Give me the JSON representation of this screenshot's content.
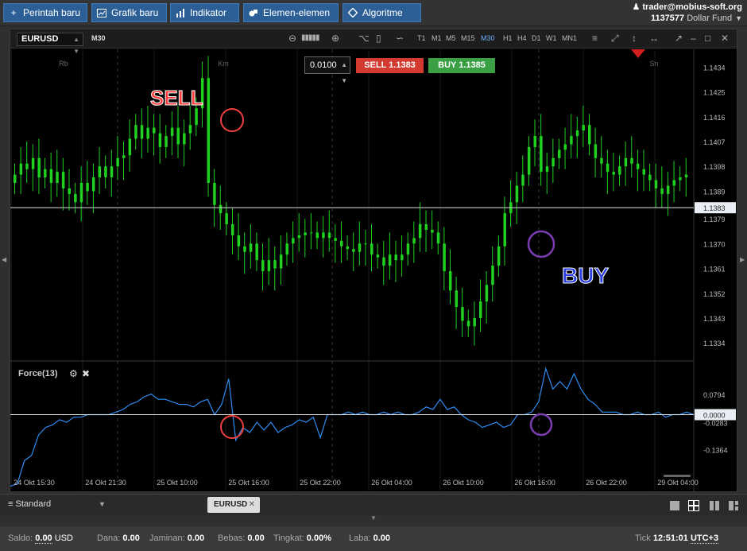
{
  "toolbar": {
    "buttons": [
      {
        "label": "Perintah baru",
        "icon": "plus-icon"
      },
      {
        "label": "Grafik baru",
        "icon": "chart-window-icon"
      },
      {
        "label": "Indikator",
        "icon": "bar-chart-icon"
      },
      {
        "label": "Elemen-elemen",
        "icon": "shapes-icon"
      },
      {
        "label": "Algoritme",
        "icon": "diamond-icon"
      }
    ]
  },
  "account": {
    "email": "trader@mobius-soft.org",
    "number": "1137577",
    "fund": "Dollar Fund"
  },
  "chart_toolbar": {
    "symbol": "EURUSD",
    "timeframe_current": "M30",
    "timeframes": [
      "T1",
      "M1",
      "M5",
      "M15",
      "M30",
      "H1",
      "H4",
      "D1",
      "W1",
      "MN1"
    ],
    "active_timeframe": "M30"
  },
  "trade": {
    "lot": "0.0100",
    "sell_label": "SELL 1.1383",
    "buy_label": "BUY 1.1385"
  },
  "annotations": {
    "sell": "SELL",
    "buy": "BUY"
  },
  "indicator": {
    "title": "Force(13)"
  },
  "chart_data": [
    {
      "type": "candlestick",
      "title": "EURUSD M30",
      "y_ticks": [
        "1.1434",
        "1.1425",
        "1.1416",
        "1.1407",
        "1.1398",
        "1.1389",
        "1.1379",
        "1.1370",
        "1.1361",
        "1.1352",
        "1.1343",
        "1.1334"
      ],
      "current_price": "1.1383",
      "day_labels": [
        "Rb",
        "Km",
        "Sn"
      ],
      "x_ticks": [
        "24 Okt 15:30",
        "24 Okt 21:30",
        "25 Okt 10:00",
        "25 Okt 16:00",
        "25 Okt 22:00",
        "26 Okt 04:00",
        "26 Okt 10:00",
        "26 Okt 16:00",
        "26 Okt 22:00",
        "29 Okt 04:00"
      ],
      "close_profile": [
        1.1395,
        1.1399,
        1.1397,
        1.1401,
        1.1394,
        1.1397,
        1.1392,
        1.1396,
        1.139,
        1.1388,
        1.1385,
        1.1392,
        1.1389,
        1.1394,
        1.1398,
        1.1394,
        1.1398,
        1.1401,
        1.1402,
        1.1408,
        1.1413,
        1.1408,
        1.1412,
        1.141,
        1.1405,
        1.1409,
        1.1412,
        1.1406,
        1.141,
        1.1413,
        1.1419,
        1.143,
        1.1392,
        1.1384,
        1.1381,
        1.1377,
        1.1373,
        1.1369,
        1.1367,
        1.137,
        1.1364,
        1.136,
        1.1364,
        1.1361,
        1.1366,
        1.137,
        1.1372,
        1.1373,
        1.1374,
        1.1374,
        1.1372,
        1.1374,
        1.1372,
        1.1371,
        1.1369,
        1.1368,
        1.1367,
        1.137,
        1.137,
        1.1366,
        1.1365,
        1.1362,
        1.1366,
        1.1364,
        1.1366,
        1.137,
        1.1372,
        1.1377,
        1.1375,
        1.1374,
        1.137,
        1.136,
        1.1353,
        1.1347,
        1.1342,
        1.134,
        1.1343,
        1.1349,
        1.1355,
        1.1362,
        1.1369,
        1.1381,
        1.1385,
        1.1391,
        1.1395,
        1.1405,
        1.1409,
        1.1396,
        1.1398,
        1.1401,
        1.1404,
        1.1406,
        1.1409,
        1.1411,
        1.1413,
        1.1406,
        1.1401,
        1.1399,
        1.1396,
        1.1395,
        1.1398,
        1.1401,
        1.1399,
        1.1397,
        1.1395,
        1.1393,
        1.139,
        1.1388,
        1.1391,
        1.1393,
        1.1394,
        1.1395
      ]
    },
    {
      "type": "line",
      "title": "Force(13)",
      "y_ticks": [
        "0.0794",
        "-0.0283",
        "-0.1364"
      ],
      "current_value": "0.0000",
      "values": [
        -0.28,
        -0.27,
        -0.18,
        -0.16,
        -0.08,
        -0.05,
        -0.04,
        -0.02,
        -0.03,
        -0.01,
        -0.01,
        0.0,
        0.0,
        0.0,
        0.0,
        0.01,
        0.02,
        0.04,
        0.05,
        0.07,
        0.08,
        0.06,
        0.06,
        0.05,
        0.04,
        0.04,
        0.03,
        0.05,
        0.06,
        0.0,
        0.04,
        0.14,
        -0.1,
        -0.05,
        -0.07,
        -0.03,
        -0.06,
        -0.03,
        -0.07,
        -0.05,
        -0.04,
        -0.02,
        -0.03,
        -0.01,
        -0.09,
        0.0,
        0.0,
        0.0,
        0.01,
        0.0,
        0.01,
        0.0,
        0.0,
        0.01,
        0.0,
        0.01,
        0.0,
        0.0,
        0.01,
        0.03,
        0.02,
        0.06,
        0.02,
        0.03,
        0.0,
        -0.02,
        -0.03,
        -0.05,
        -0.04,
        -0.03,
        -0.05,
        -0.04,
        0.0,
        0.0,
        0.01,
        0.05,
        0.18,
        0.1,
        0.13,
        0.1,
        0.16,
        0.1,
        0.06,
        0.04,
        0.01,
        0.01,
        0.01,
        0.0,
        0.0,
        0.01,
        0.0,
        0.0,
        0.01,
        -0.01,
        0.0,
        0.0,
        0.01,
        0.0
      ]
    }
  ],
  "tabs": {
    "layout": "Standard",
    "active": "EURUSD"
  },
  "status": {
    "saldo_label": "Saldo:",
    "saldo_value": "0.00",
    "currency": "USD",
    "dana_label": "Dana:",
    "dana_value": "0.00",
    "jaminan_label": "Jaminan:",
    "jaminan_value": "0.00",
    "bebas_label": "Bebas:",
    "bebas_value": "0.00",
    "tingkat_label": "Tingkat:",
    "tingkat_value": "0.00%",
    "laba_label": "Laba:",
    "laba_value": "0.00",
    "tick_label": "Tick",
    "time": "12:51:01",
    "tz": "UTC+3"
  },
  "colors": {
    "bull": "#1fd21f",
    "bear": "#1fd21f",
    "force_line": "#2f8cf0",
    "sell": "#d33a30",
    "buy": "#39a043",
    "accent": "#2c5f95"
  }
}
